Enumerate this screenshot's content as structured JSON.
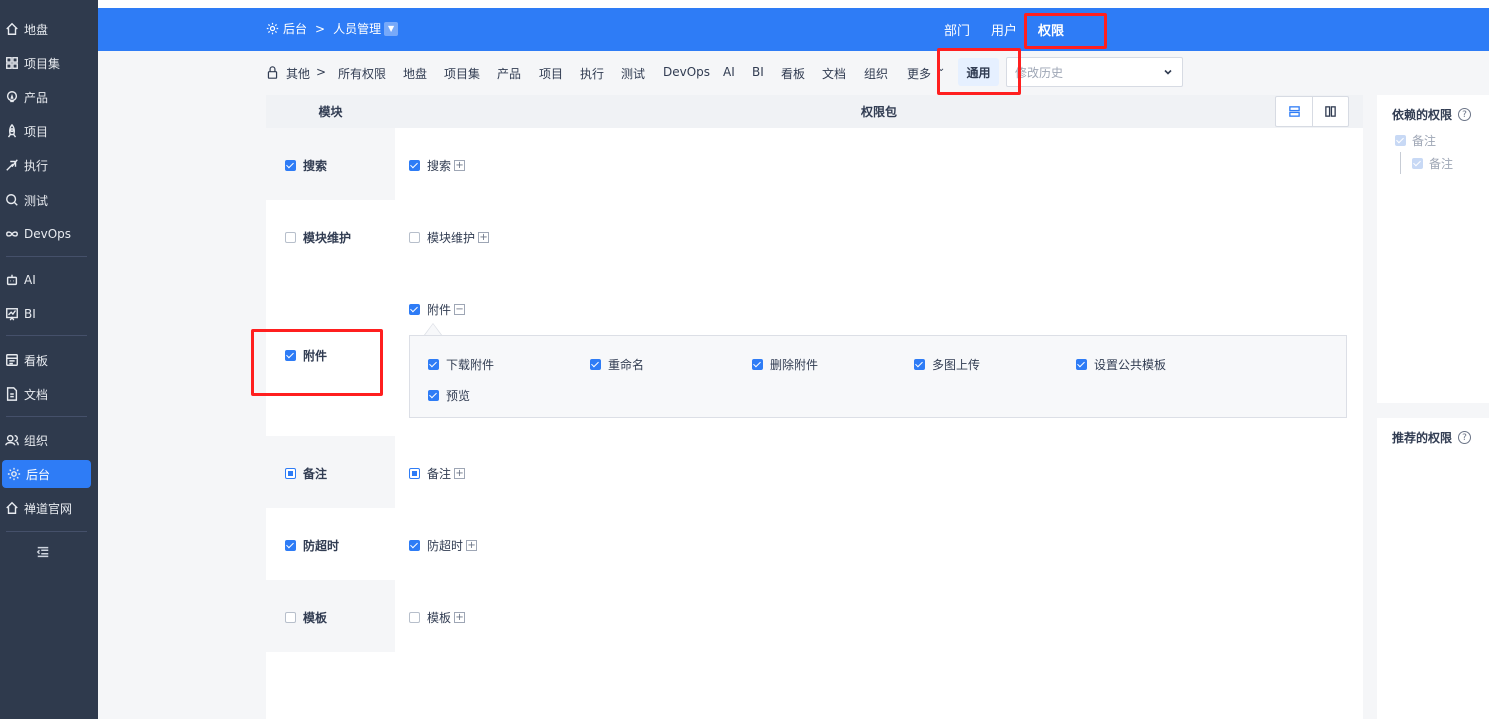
{
  "sidebar": {
    "items": [
      {
        "label": "地盘",
        "icon": "home-icon"
      },
      {
        "label": "项目集",
        "icon": "grid-icon"
      },
      {
        "label": "产品",
        "icon": "lightbulb-icon"
      },
      {
        "label": "项目",
        "icon": "rocket-icon"
      },
      {
        "label": "执行",
        "icon": "run-icon"
      },
      {
        "label": "测试",
        "icon": "search-icon"
      },
      {
        "label": "DevOps",
        "icon": "infinity-icon"
      },
      {
        "label": "AI",
        "icon": "robot-icon"
      },
      {
        "label": "BI",
        "icon": "chart-icon"
      },
      {
        "label": "看板",
        "icon": "kanban-icon"
      },
      {
        "label": "文档",
        "icon": "document-icon"
      },
      {
        "label": "组织",
        "icon": "users-icon"
      },
      {
        "label": "后台",
        "icon": "gear-icon"
      },
      {
        "label": "禅道官网",
        "icon": "home-icon"
      }
    ],
    "active_index": 12
  },
  "header": {
    "breadcrumb_root": "后台",
    "breadcrumb_current": "人员管理",
    "tabs": [
      {
        "label": "部门"
      },
      {
        "label": "用户"
      },
      {
        "label": "权限"
      }
    ],
    "active_tab": "权限"
  },
  "subnav": {
    "items": [
      "其他",
      "所有权限",
      "地盘",
      "项目集",
      "产品",
      "项目",
      "执行",
      "测试",
      "DevOps",
      "AI",
      "BI",
      "看板",
      "文档",
      "组织",
      "更多"
    ],
    "active": "通用",
    "history_placeholder": "修改历史"
  },
  "table": {
    "col_module": "模块",
    "col_package": "权限包",
    "rows": [
      {
        "module": "搜索",
        "state": "on",
        "package": "搜索",
        "pkg_state": "on",
        "toggle": "+"
      },
      {
        "module": "模块维护",
        "state": "off",
        "package": "模块维护",
        "pkg_state": "off",
        "toggle": "+"
      },
      {
        "module": "附件",
        "state": "on",
        "package": "附件",
        "pkg_state": "on",
        "toggle": "−"
      },
      {
        "module": "备注",
        "state": "part",
        "package": "备注",
        "pkg_state": "part",
        "toggle": "+"
      },
      {
        "module": "防超时",
        "state": "on",
        "package": "防超时",
        "pkg_state": "on",
        "toggle": "+"
      },
      {
        "module": "模板",
        "state": "off",
        "package": "模板",
        "pkg_state": "off",
        "toggle": "+"
      }
    ],
    "attachment_permissions": [
      "下载附件",
      "重命名",
      "删除附件",
      "多图上传",
      "设置公共模板",
      "预览"
    ]
  },
  "right": {
    "depend_title": "依赖的权限",
    "depend_items": [
      "备注",
      "备注"
    ],
    "recommend_title": "推荐的权限"
  },
  "colors": {
    "accent": "#2e7cf6",
    "sidebar_bg": "#2f3a4d",
    "annotation": "#ff1f1f"
  }
}
